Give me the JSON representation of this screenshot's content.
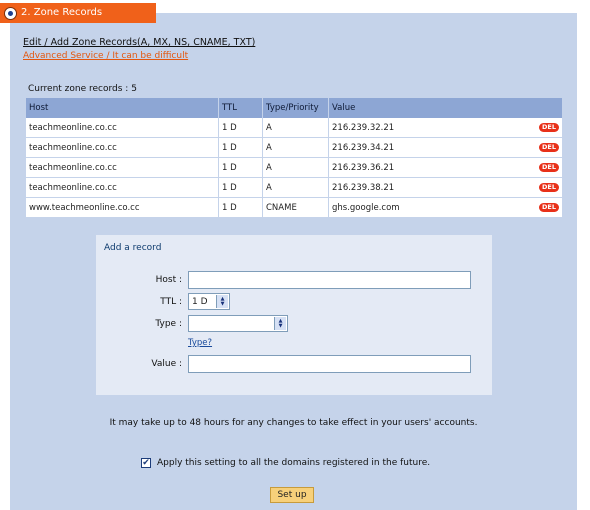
{
  "tab": {
    "label": "2. Zone Records"
  },
  "header": {
    "title": "Edit / Add Zone Records(A, MX, NS, CNAME, TXT)",
    "advanced_link": "Advanced Service / It can be difficult"
  },
  "records": {
    "count_text": "Current zone records : 5",
    "columns": [
      "Host",
      "TTL",
      "Type/Priority",
      "Value"
    ],
    "delete_label": "DEL",
    "rows": [
      {
        "host": "teachmeonline.co.cc",
        "ttl": "1 D",
        "type": "A",
        "value": "216.239.32.21"
      },
      {
        "host": "teachmeonline.co.cc",
        "ttl": "1 D",
        "type": "A",
        "value": "216.239.34.21"
      },
      {
        "host": "teachmeonline.co.cc",
        "ttl": "1 D",
        "type": "A",
        "value": "216.239.36.21"
      },
      {
        "host": "teachmeonline.co.cc",
        "ttl": "1 D",
        "type": "A",
        "value": "216.239.38.21"
      },
      {
        "host": "www.teachmeonline.co.cc",
        "ttl": "1 D",
        "type": "CNAME",
        "value": "ghs.google.com"
      }
    ]
  },
  "add_record": {
    "title": "Add a record",
    "host_label": "Host :",
    "host_value": "",
    "ttl_label": "TTL :",
    "ttl_value": "1 D",
    "type_label": "Type :",
    "type_value": "",
    "type_help_link": "Type?",
    "value_label": "Value :",
    "value_value": ""
  },
  "notice": "It may take up to 48 hours for any changes to take effect in your users' accounts.",
  "apply_checkbox": {
    "label": "Apply this setting to all the domains registered in the future.",
    "checked": true
  },
  "setup_button": "Set up",
  "colors": {
    "tab": "#f0611a",
    "panel": "#c5d3ea",
    "table_header": "#8da6d4",
    "del_badge": "#e8311a",
    "button": "#f7d07a"
  },
  "icons": {
    "tab_radio": "radio-selected-icon",
    "spinner": "spinner-arrows-icon",
    "checkbox": "checkmark-icon"
  }
}
